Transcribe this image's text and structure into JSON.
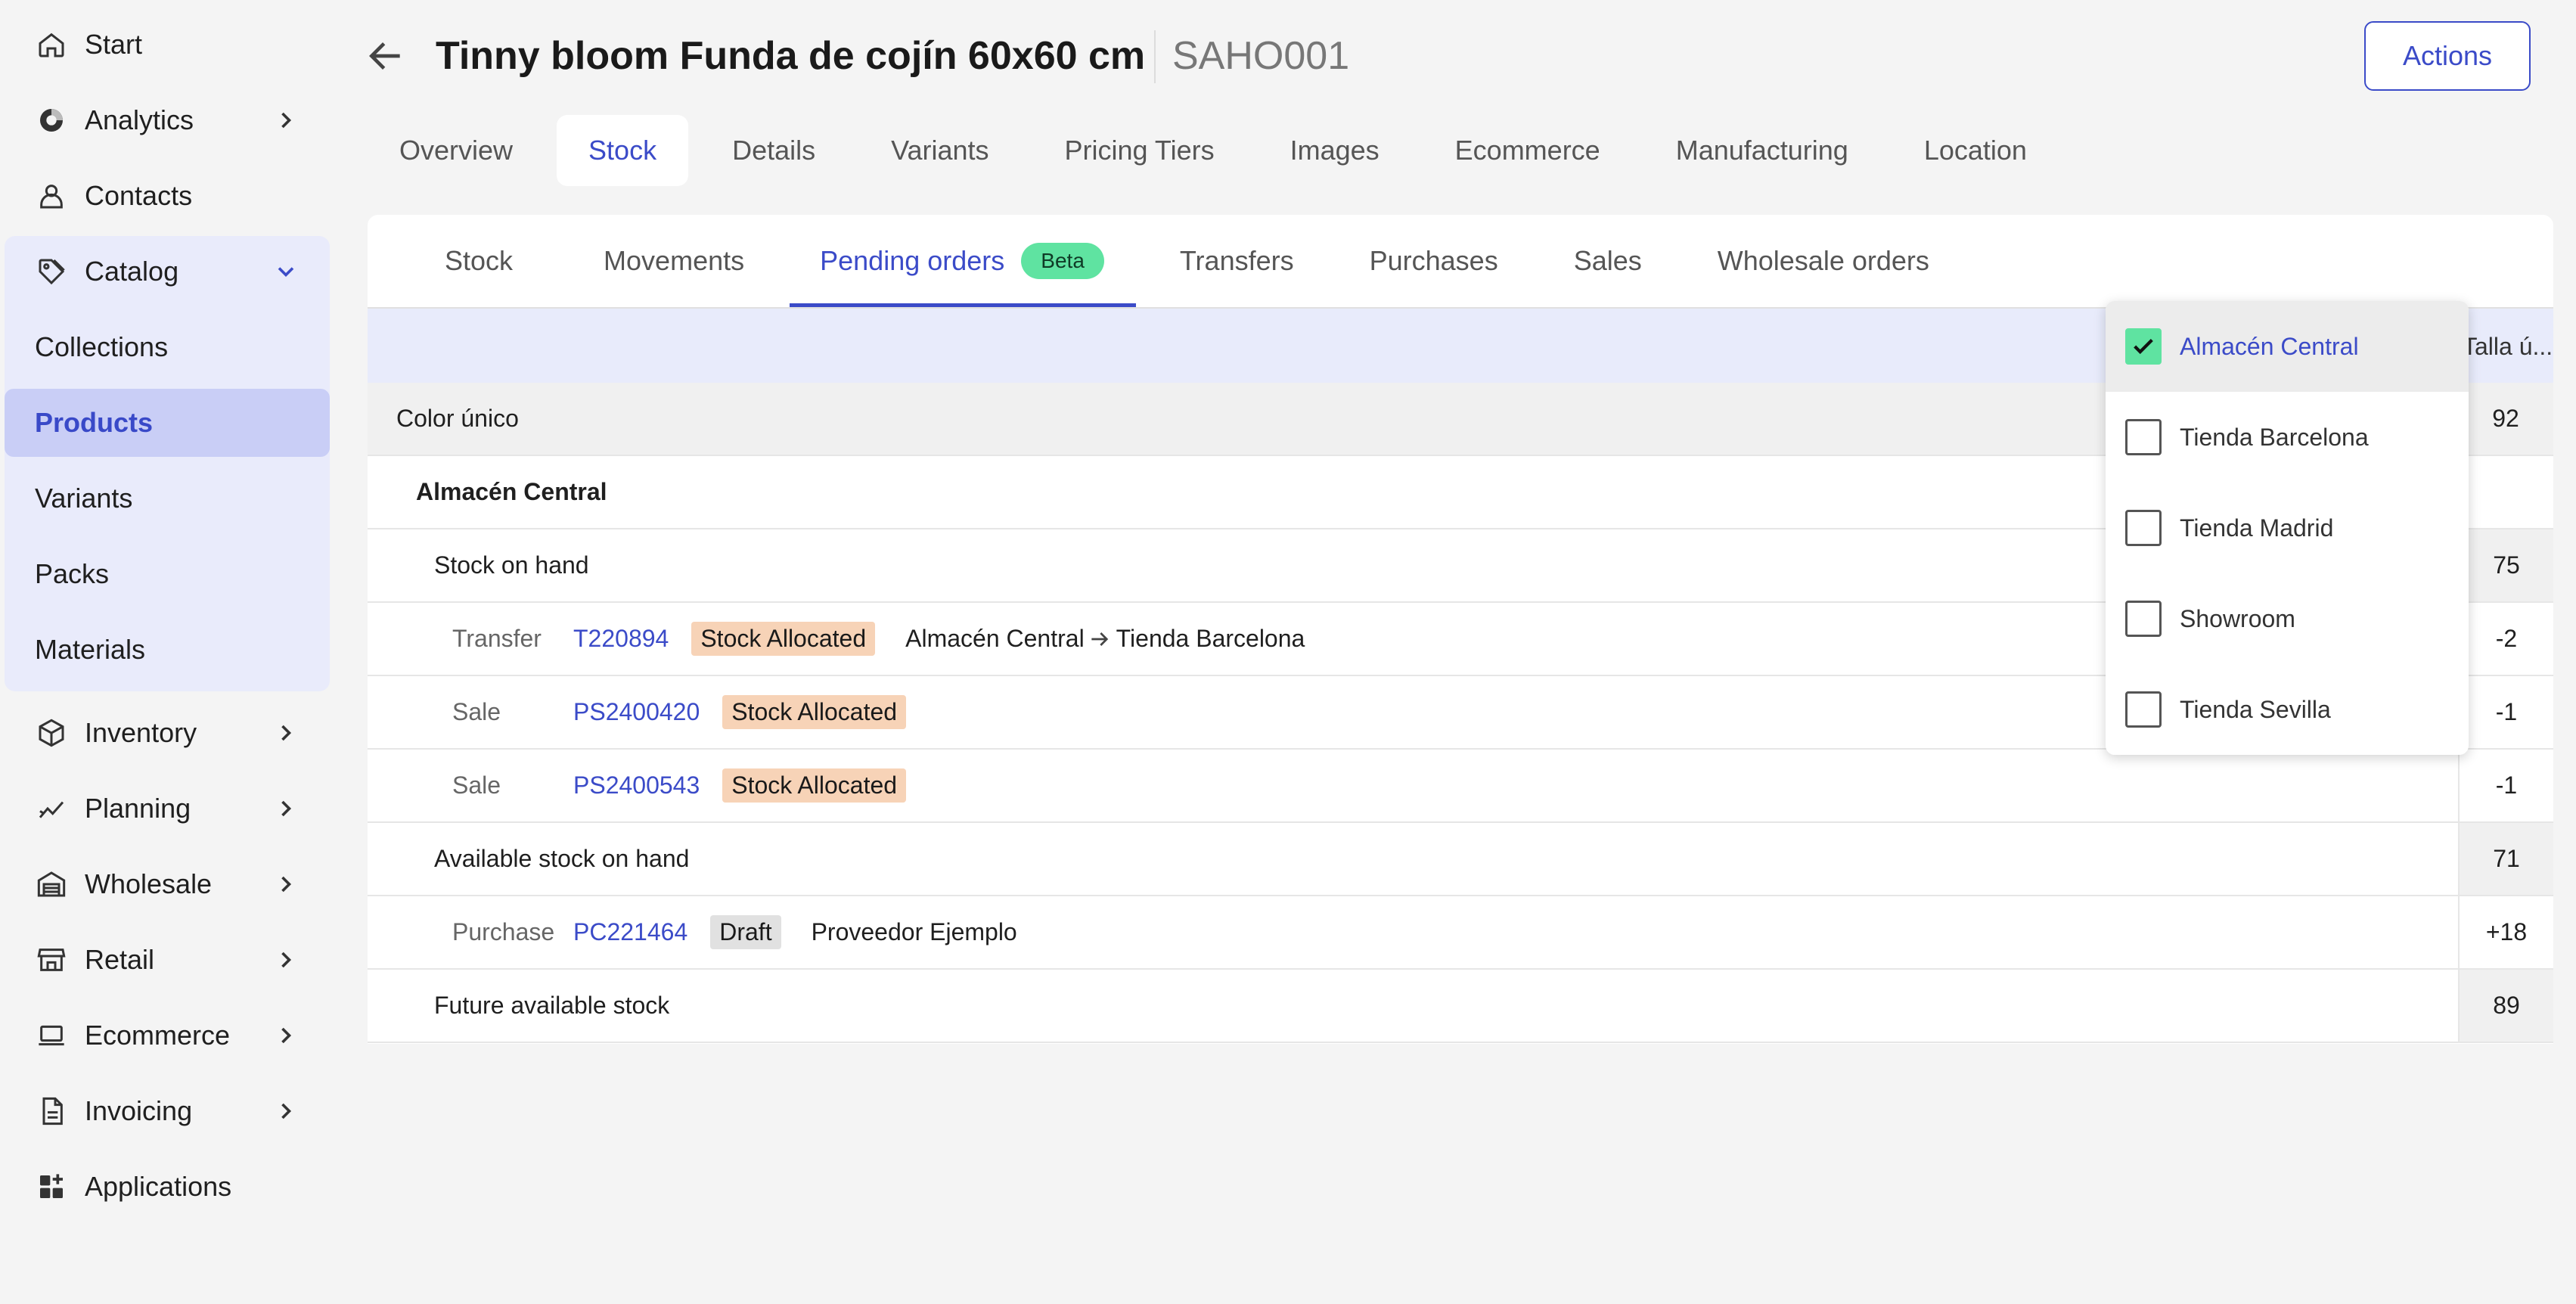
{
  "sidebar": {
    "items": [
      {
        "label": "Start",
        "icon": "home-icon"
      },
      {
        "label": "Analytics",
        "icon": "analytics-icon"
      },
      {
        "label": "Contacts",
        "icon": "person-icon"
      },
      {
        "label": "Catalog",
        "icon": "tag-icon"
      },
      {
        "label": "Inventory",
        "icon": "box-icon"
      },
      {
        "label": "Planning",
        "icon": "trend-icon"
      },
      {
        "label": "Wholesale",
        "icon": "warehouse-icon"
      },
      {
        "label": "Retail",
        "icon": "store-icon"
      },
      {
        "label": "Ecommerce",
        "icon": "laptop-icon"
      },
      {
        "label": "Invoicing",
        "icon": "document-icon"
      },
      {
        "label": "Applications",
        "icon": "apps-icon"
      }
    ],
    "catalog_sub": [
      "Collections",
      "Products",
      "Variants",
      "Packs",
      "Materials"
    ]
  },
  "header": {
    "title": "Tinny bloom Funda de cojín 60x60 cm",
    "sku": "SAHO001",
    "actions_label": "Actions"
  },
  "main_tabs": [
    "Overview",
    "Stock",
    "Details",
    "Variants",
    "Pricing Tiers",
    "Images",
    "Ecommerce",
    "Manufacturing",
    "Location"
  ],
  "sub_tabs": {
    "items": [
      "Stock",
      "Movements",
      "Pending orders",
      "Transfers",
      "Purchases",
      "Sales",
      "Wholesale orders"
    ],
    "beta_label": "Beta"
  },
  "table": {
    "column_header": "Talla ú...",
    "variant": {
      "label": "Color único",
      "value": "92"
    },
    "warehouse": "Almacén Central",
    "stock_on_hand": {
      "label": "Stock on hand",
      "value": "75"
    },
    "movements": [
      {
        "type": "Transfer",
        "ref": "T220894",
        "status": "Stock Allocated",
        "from": "Almacén Central",
        "to": "Tienda Barcelona",
        "value": "-2"
      },
      {
        "type": "Sale",
        "ref": "PS2400420",
        "status": "Stock Allocated",
        "value": "-1"
      },
      {
        "type": "Sale",
        "ref": "PS2400543",
        "status": "Stock Allocated",
        "value": "-1"
      }
    ],
    "available": {
      "label": "Available stock on hand",
      "value": "71"
    },
    "purchase": {
      "type": "Purchase",
      "ref": "PC221464",
      "status": "Draft",
      "supplier": "Proveedor Ejemplo",
      "value": "+18"
    },
    "future": {
      "label": "Future available stock",
      "value": "89"
    }
  },
  "location_filter": {
    "options": [
      {
        "label": "Almacén Central",
        "checked": true
      },
      {
        "label": "Tienda Barcelona",
        "checked": false
      },
      {
        "label": "Tienda Madrid",
        "checked": false
      },
      {
        "label": "Showroom",
        "checked": false
      },
      {
        "label": "Tienda Sevilla",
        "checked": false
      }
    ]
  },
  "colors": {
    "accent": "#3b4bc8",
    "beta": "#5fe3a1",
    "allocated": "#f7d3b7",
    "draft": "#e1e1e1"
  }
}
